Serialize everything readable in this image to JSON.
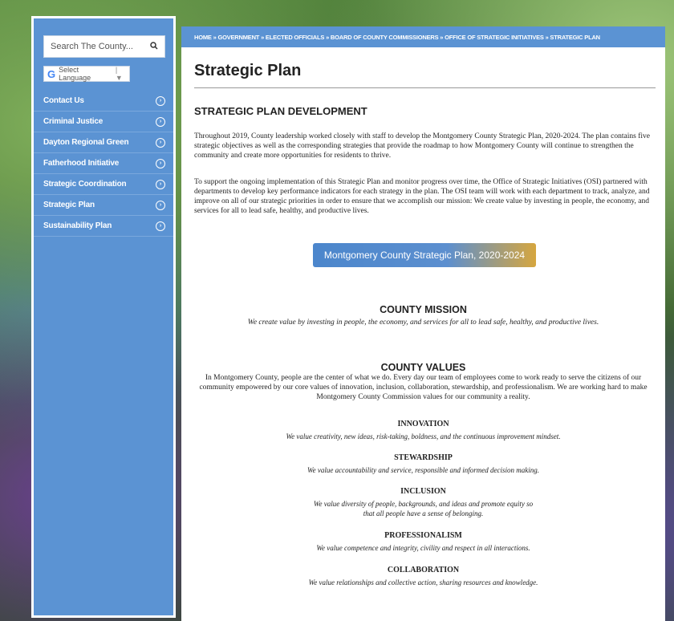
{
  "sidebar": {
    "search_placeholder": "Search The County...",
    "language_label": "Select Language",
    "language_arrow": "▼",
    "items": [
      {
        "label": "Contact Us"
      },
      {
        "label": "Criminal Justice"
      },
      {
        "label": "Dayton Regional Green"
      },
      {
        "label": "Fatherhood Initiative"
      },
      {
        "label": "Strategic Coordination"
      },
      {
        "label": "Strategic Plan"
      },
      {
        "label": "Sustainability Plan"
      }
    ]
  },
  "breadcrumb": "HOME » GOVERNMENT » ELECTED OFFICIALS » BOARD OF COUNTY COMMISSIONERS » OFFICE OF STRATEGIC INITIATIVES » STRATEGIC PLAN",
  "page_title": "Strategic Plan",
  "section_heading": "STRATEGIC PLAN DEVELOPMENT",
  "paragraph1": "Throughout 2019, County leadership worked closely with staff to develop the Montgomery County Strategic Plan, 2020-2024. The plan contains five strategic objectives as well as the corresponding strategies that provide the roadmap to how Montgomery County will continue to strengthen the community and create more opportunities for residents to thrive.",
  "paragraph2": "To support the ongoing implementation of this Strategic Plan and monitor progress over time, the Office of Strategic Initiatives (OSI) partnered with departments to develop key performance indicators for each strategy in the plan. The OSI team will work with each department to track, analyze, and improve on all of our strategic priorities in order to ensure that we accomplish our mission: We create value by investing in people, the economy, and services for all to lead safe, healthy, and productive lives.",
  "plan_button": "Montgomery County Strategic Plan, 2020-2024",
  "mission": {
    "title": "COUNTY MISSION",
    "text": "We create value by investing in people, the economy, and services for all to lead safe, healthy, and productive lives."
  },
  "values": {
    "title": "COUNTY VALUES",
    "text": "In Montgomery County, people are the center of what we do. Every day our team of employees come to work ready to serve the citizens of our community empowered by our core values of innovation, inclusion, collaboration, stewardship, and professionalism. We are working hard to make Montgomery County Commission values for our community a reality.",
    "items": [
      {
        "name": "INNOVATION",
        "desc": "We value creativity, new ideas, risk-taking, boldness, and the continuous improvement mindset."
      },
      {
        "name": "STEWARDSHIP",
        "desc": "We value accountability and service, responsible and informed decision making."
      },
      {
        "name": "INCLUSION",
        "desc": "We value diversity of people, backgrounds, and ideas and promote equity so that all people have a sense of belonging."
      },
      {
        "name": "PROFESSIONALISM",
        "desc": "We value competence and integrity, civility and respect in all interactions."
      },
      {
        "name": "COLLABORATION",
        "desc": "We value relationships and collective action, sharing resources and knowledge."
      }
    ]
  },
  "icons": {
    "search": "search-icon",
    "nav_arrow": "circle-arrow-right-icon"
  }
}
